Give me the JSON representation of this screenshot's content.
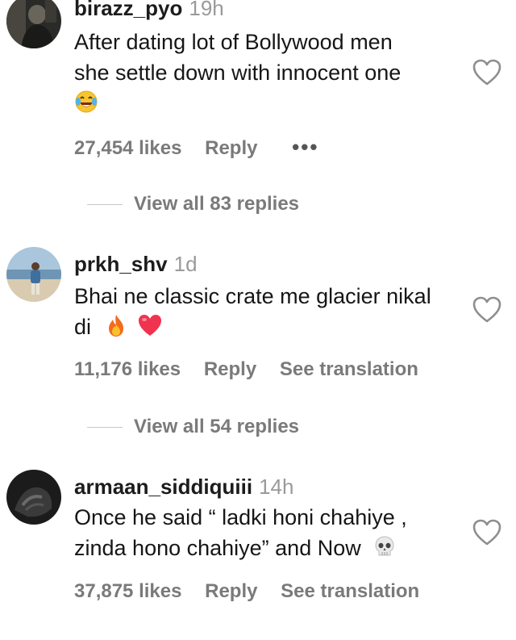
{
  "comments": [
    {
      "username": "birazz_pyo",
      "time": "19h",
      "lines": [
        "After dating lot of Bollywood men",
        "she settle down with innocent one"
      ],
      "emojis": [
        "laughing-tears"
      ],
      "likes": "27,454 likes",
      "reply_label": "Reply",
      "more_label": "•••",
      "view_replies": "View all 83 replies"
    },
    {
      "username": "prkh_shv",
      "time": "1d",
      "lines": [
        "Bhai ne classic crate me glacier nikal",
        "di"
      ],
      "emojis": [
        "fire",
        "red-heart"
      ],
      "likes": "11,176 likes",
      "reply_label": "Reply",
      "translation_label": "See translation",
      "view_replies": "View all 54 replies"
    },
    {
      "username": "armaan_siddiquiii",
      "time": "14h",
      "lines": [
        "Once he said “ ladki honi chahiye ,",
        "zinda hono chahiye” and Now"
      ],
      "emojis": [
        "skull"
      ],
      "likes": "37,875 likes",
      "reply_label": "Reply",
      "translation_label": "See translation"
    }
  ],
  "icons": {
    "like": "heart-outline-icon"
  }
}
